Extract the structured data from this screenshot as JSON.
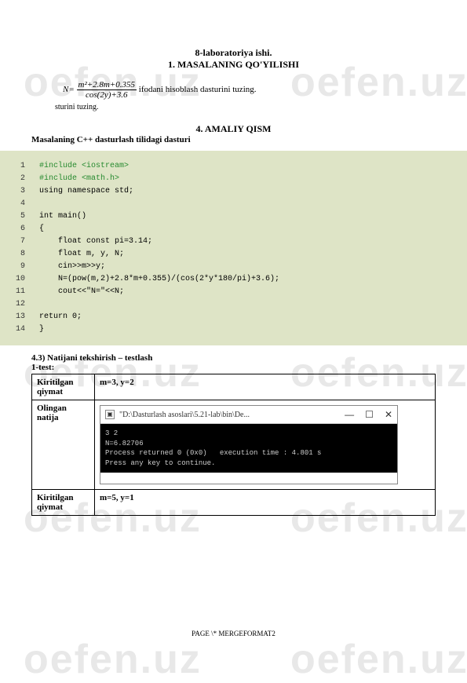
{
  "watermarkText": "oefen.uz",
  "title1": "8-laboratoriya ishi.",
  "title2": "1. MASALANING QO'YILISHI",
  "formula": {
    "lhs": "N=",
    "numerator": "m²+2.8m+0.355",
    "denom": "cos(2y)+3.6",
    "desc": " ifodani hisoblash dasturini tuzing."
  },
  "sturini": "sturini tuzing.",
  "section4": "4. AMALIY QISM",
  "cppTitle": "Masalaning C++ dasturlash tilidagi dasturi",
  "code": [
    {
      "n": "1",
      "text": "#include <iostream>"
    },
    {
      "n": "2",
      "text": "#include <math.h>"
    },
    {
      "n": "3",
      "text": "using namespace std;"
    },
    {
      "n": "4",
      "text": ""
    },
    {
      "n": "5",
      "text": "int main()"
    },
    {
      "n": "6",
      "text": "{"
    },
    {
      "n": "7",
      "text": "    float const pi=3.14;"
    },
    {
      "n": "8",
      "text": "    float m, y, N;"
    },
    {
      "n": "9",
      "text": "    cin>>m>>y;"
    },
    {
      "n": "10",
      "text": "    N=(pow(m,2)+2.8*m+0.355)/(cos(2*y*180/pi)+3.6);"
    },
    {
      "n": "11",
      "text": "    cout<<\"N=\"<<N;"
    },
    {
      "n": "12",
      "text": ""
    },
    {
      "n": "13",
      "text": "return 0;"
    },
    {
      "n": "14",
      "text": "}"
    }
  ],
  "testTitle": "4.3) Natijani tekshirish – testlash",
  "test1Label": "1-test:",
  "table": {
    "r1c1": "Kiritilgan qiymat",
    "r1c2": "m=3, y=2",
    "r2c1": "Olingan natija",
    "r3c1": "Kiritilgan qiymat",
    "r3c2": "m=5, y=1"
  },
  "console": {
    "windowTitle": "\"D:\\Dasturlash asoslari\\5.21-lab\\bin\\De...",
    "line1": "3 2",
    "line2": "N=6.82706",
    "line3": "Process returned 0 (0x0)   execution time : 4.801 s",
    "line4": "Press any key to continue."
  },
  "footer": "PAGE   \\* MERGEFORMAT2"
}
